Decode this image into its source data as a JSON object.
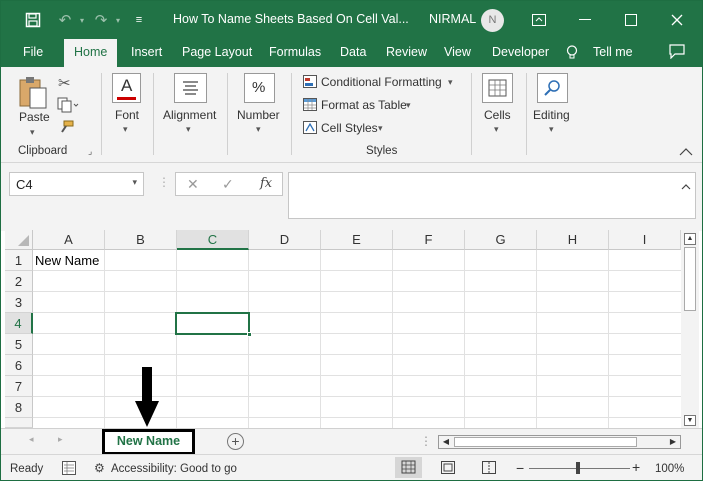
{
  "title_bar": {
    "document_title": "How To Name Sheets Based On Cell Val...",
    "user_name": "NIRMAL",
    "user_initial": "N",
    "icons": [
      "save-icon",
      "undo-icon",
      "redo-icon",
      "customize-qat-icon",
      "ribbon-display-icon",
      "minimize-icon",
      "restore-icon",
      "close-icon"
    ]
  },
  "menu": {
    "tabs": [
      "File",
      "Home",
      "Insert",
      "Page Layout",
      "Formulas",
      "Data",
      "Review",
      "View",
      "Developer"
    ],
    "active_tab": "Home",
    "tell_me": "Tell me"
  },
  "ribbon": {
    "clipboard": {
      "paste": "Paste",
      "group": "Clipboard"
    },
    "font": {
      "label": "Font"
    },
    "alignment": {
      "label": "Alignment"
    },
    "number": {
      "label": "Number"
    },
    "styles": {
      "conditional_formatting": "Conditional Formatting",
      "format_as_table": "Format as Table",
      "cell_styles": "Cell Styles",
      "group": "Styles"
    },
    "cells": {
      "label": "Cells"
    },
    "editing": {
      "label": "Editing"
    }
  },
  "formula_bar": {
    "name_box": "C4",
    "formula": ""
  },
  "sheet": {
    "columns": [
      "A",
      "B",
      "C",
      "D",
      "E",
      "F",
      "G",
      "H",
      "I"
    ],
    "rows": [
      "1",
      "2",
      "3",
      "4",
      "5",
      "6",
      "7",
      "8"
    ],
    "selected_column": "C",
    "selected_row": "4",
    "cells": {
      "A1": "New Name"
    }
  },
  "sheet_tabs": {
    "active_tab": "New Name"
  },
  "status_bar": {
    "ready": "Ready",
    "accessibility": "Accessibility: Good to go",
    "zoom": "100%"
  },
  "colors": {
    "brand": "#217346",
    "ribbon_bg": "#f3f3f3",
    "annotation": "#000000"
  }
}
